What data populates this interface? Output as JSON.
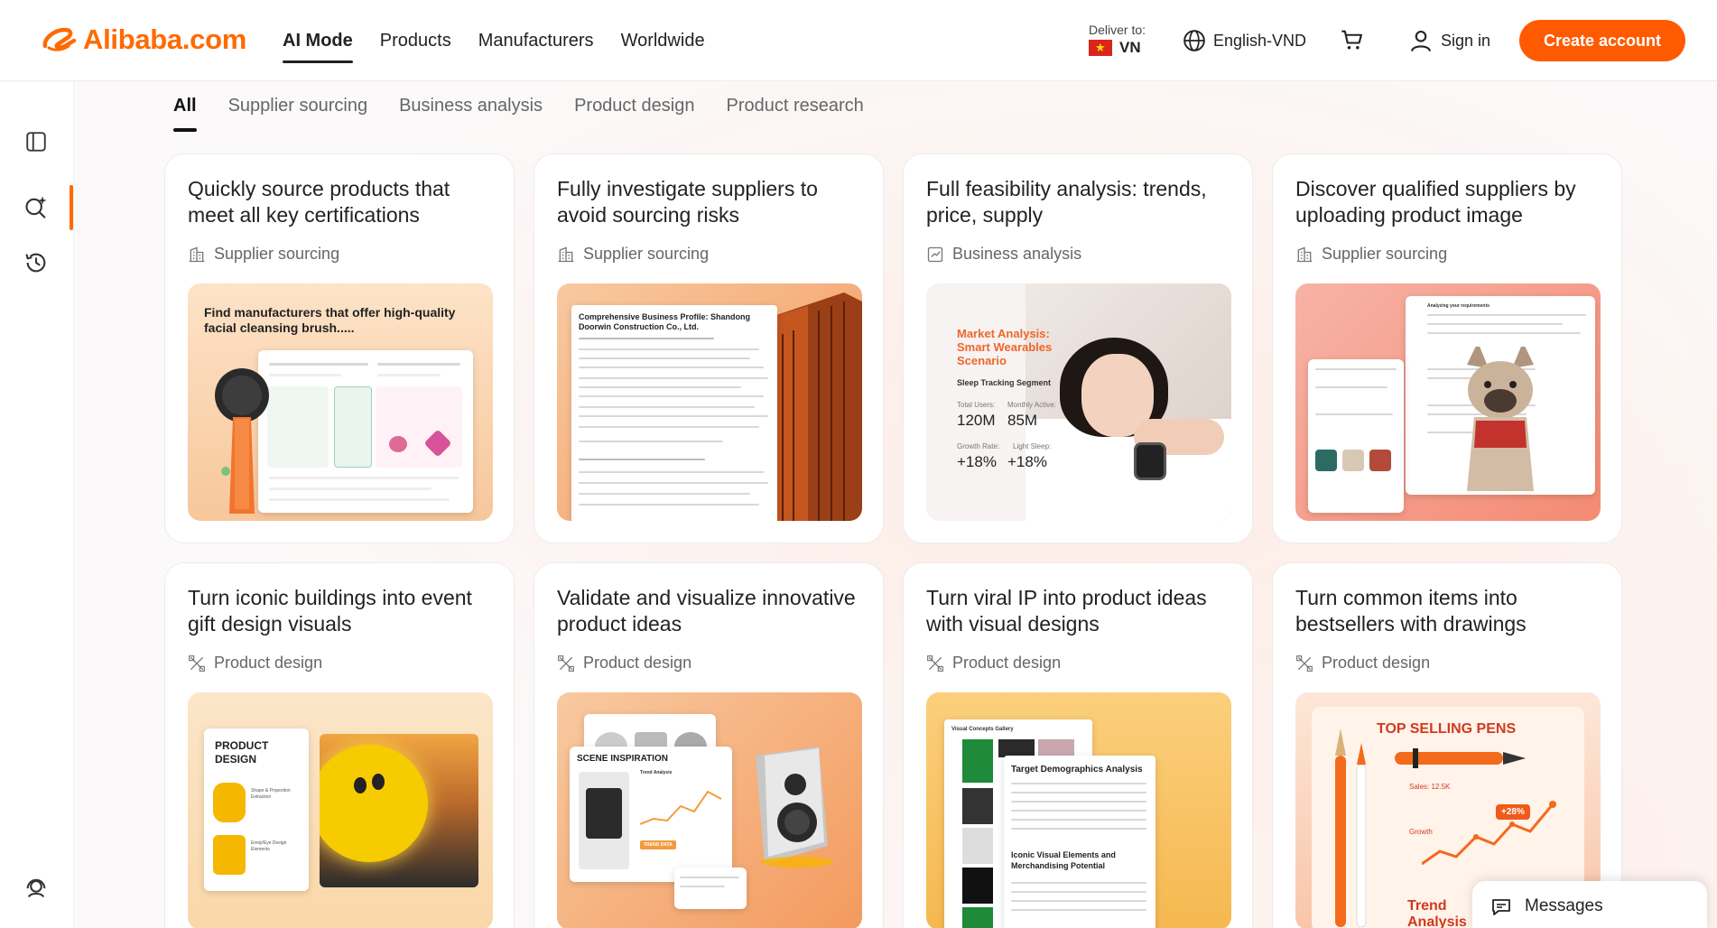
{
  "header": {
    "logo_text": "Alibaba.com",
    "nav": [
      "AI Mode",
      "Products",
      "Manufacturers",
      "Worldwide"
    ],
    "deliver_label": "Deliver to:",
    "deliver_country": "VN",
    "language": "English-VND",
    "signin": "Sign in",
    "create_account": "Create account"
  },
  "tabs": [
    "All",
    "Supplier sourcing",
    "Business analysis",
    "Product design",
    "Product research"
  ],
  "cards": [
    {
      "title": "Quickly source products that meet all key certifications",
      "category": "Supplier sourcing",
      "image_text": "Find manufacturers that offer high-quality facial cleansing brush....."
    },
    {
      "title": "Fully investigate suppliers to avoid sourcing risks",
      "category": "Supplier sourcing",
      "image_text": "Comprehensive Business Profile: Shandong Doorwin Construction Co., Ltd."
    },
    {
      "title": "Full feasibility analysis: trends, price, supply",
      "category": "Business analysis",
      "image_text": "Market Analysis: Smart Wearables Scenario",
      "segment": "Sleep Tracking Segment",
      "stats": [
        {
          "label": "Total Users:",
          "value": "120M"
        },
        {
          "label": "Monthly Active:",
          "value": "85M"
        },
        {
          "label": "Growth Rate:",
          "value": "+18%"
        },
        {
          "label": "Light Sleep:",
          "value": "+18%"
        }
      ]
    },
    {
      "title": "Discover qualified suppliers by uploading product image",
      "category": "Supplier sourcing",
      "image_text": "Analyzing your requirements"
    },
    {
      "title": "Turn iconic buildings into event gift design visuals",
      "category": "Product design",
      "image_text": "PRODUCT DESIGN",
      "sub1": "Shape & Proportion Extraction",
      "sub2": "Emoji/Eye Design Elements"
    },
    {
      "title": "Validate and visualize innovative product ideas",
      "category": "Product design",
      "image_text": "SCENE INSPIRATION",
      "sub1": "Trend Analysis",
      "sub2": "TREND DATA"
    },
    {
      "title": "Turn viral IP into product ideas with visual designs",
      "category": "Product design",
      "image_text": "Target Demographics Analysis",
      "sub1": "Iconic Visual Elements and Merchandising Potential",
      "sub2": "Visual Concepts Gallery"
    },
    {
      "title": "Turn common items into bestsellers with drawings",
      "category": "Product design",
      "image_text": "TOP SELLING PENS",
      "sub1": "Sales: 12.5K",
      "sub2": "+28%",
      "sub3": "Growth",
      "sub4": "Trend Analysis"
    }
  ],
  "messages": "Messages",
  "colors": {
    "brand": "#ff6a00",
    "cta": "#ff5a00"
  }
}
